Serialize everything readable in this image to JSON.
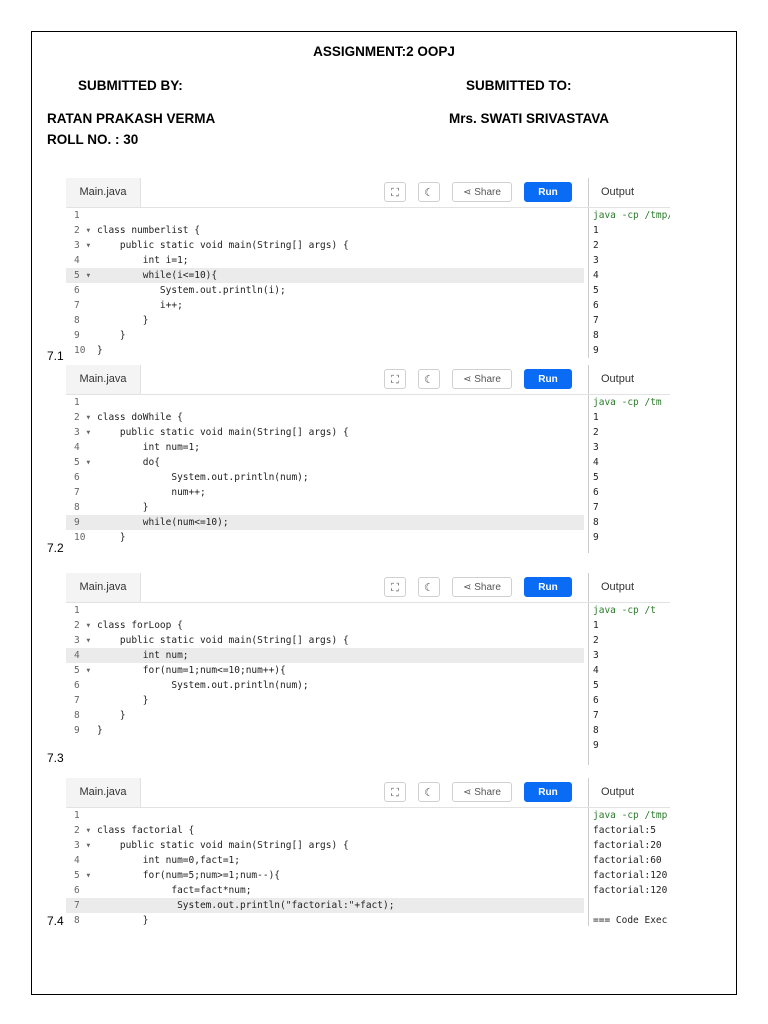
{
  "document": {
    "title": "ASSIGNMENT:2 OOPJ",
    "submitted_by_label": "SUBMITTED BY:",
    "submitted_to_label": "SUBMITTED TO:",
    "student_name": "RATAN PRAKASH VERMA",
    "roll_no": "ROLL NO. : 30",
    "teacher_name": "Mrs. SWATI SRIVASTAVA"
  },
  "toolbar": {
    "tab_label": "Main.java",
    "fullscreen_icon": "⛶",
    "theme_icon": "☾",
    "share_label": "Share",
    "share_icon": "⋖",
    "run_label": "Run",
    "output_label": "Output"
  },
  "programs": [
    {
      "label": "7.1",
      "lines": [
        {
          "n": "1",
          "t": ""
        },
        {
          "n": "2 ▾",
          "t": "class numberlist {"
        },
        {
          "n": "3 ▾",
          "t": "    public static void main(String[] args) {"
        },
        {
          "n": "4",
          "t": "        int i=1;"
        },
        {
          "n": "5 ▾",
          "t": "        while(i<=10){",
          "hl": true
        },
        {
          "n": "6",
          "t": "           System.out.println(i);"
        },
        {
          "n": "7",
          "t": "           i++;"
        },
        {
          "n": "8",
          "t": "        }"
        },
        {
          "n": "9",
          "t": "    }"
        },
        {
          "n": "10",
          "t": "}"
        }
      ],
      "output": [
        "java -cp /tmp/",
        "1",
        "2",
        "3",
        "4",
        "5",
        "6",
        "7",
        "8",
        "9"
      ]
    },
    {
      "label": "7.2",
      "lines": [
        {
          "n": "1",
          "t": ""
        },
        {
          "n": "2 ▾",
          "t": "class doWhile {"
        },
        {
          "n": "3 ▾",
          "t": "    public static void main(String[] args) {"
        },
        {
          "n": "4",
          "t": "        int num=1;"
        },
        {
          "n": "5 ▾",
          "t": "        do{"
        },
        {
          "n": "6",
          "t": "             System.out.println(num);"
        },
        {
          "n": "7",
          "t": "             num++;"
        },
        {
          "n": "8",
          "t": "        }"
        },
        {
          "n": "9",
          "t": "        while(num<=10);",
          "hl": true
        },
        {
          "n": "10",
          "t": "    }"
        }
      ],
      "output": [
        "java -cp /tm",
        "1",
        "2",
        "3",
        "4",
        "5",
        "6",
        "7",
        "8",
        "9"
      ]
    },
    {
      "label": "7.3",
      "lines": [
        {
          "n": "1",
          "t": ""
        },
        {
          "n": "2 ▾",
          "t": "class forLoop {"
        },
        {
          "n": "3 ▾",
          "t": "    public static void main(String[] args) {"
        },
        {
          "n": "4",
          "t": "        int num;",
          "hl": true
        },
        {
          "n": "5 ▾",
          "t": "        for(num=1;num<=10;num++){"
        },
        {
          "n": "6",
          "t": "             System.out.println(num);"
        },
        {
          "n": "7",
          "t": "        }"
        },
        {
          "n": "8",
          "t": "    }"
        },
        {
          "n": "9",
          "t": "}"
        }
      ],
      "output": [
        "java -cp /t",
        "1",
        "2",
        "3",
        "4",
        "5",
        "6",
        "7",
        "8",
        "9"
      ]
    },
    {
      "label": "7.4",
      "lines": [
        {
          "n": "1",
          "t": ""
        },
        {
          "n": "2 ▾",
          "t": "class factorial {"
        },
        {
          "n": "3 ▾",
          "t": "    public static void main(String[] args) {"
        },
        {
          "n": "4",
          "t": "        int num=0,fact=1;"
        },
        {
          "n": "5 ▾",
          "t": "        for(num=5;num>=1;num--){"
        },
        {
          "n": "6",
          "t": "             fact=fact*num;"
        },
        {
          "n": "7",
          "t": "              System.out.println(\"factorial:\"+fact);",
          "hl": true
        },
        {
          "n": "8",
          "t": "        }"
        }
      ],
      "output": [
        "java -cp /tmp",
        "factorial:5",
        "factorial:20",
        "factorial:60",
        "factorial:120",
        "factorial:120",
        "",
        "=== Code Exec"
      ]
    }
  ]
}
